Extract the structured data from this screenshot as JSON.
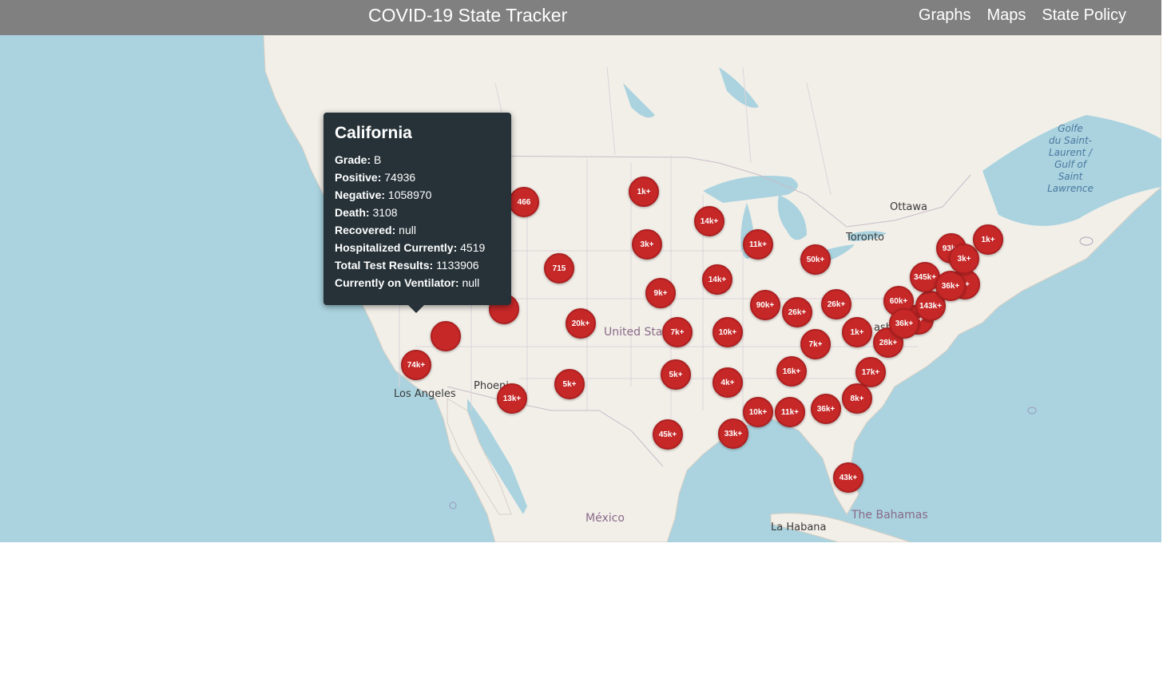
{
  "header": {
    "title": "COVID-19 State Tracker",
    "nav": [
      "Graphs",
      "Maps",
      "State Policy"
    ]
  },
  "map": {
    "water_color": "#aad3df",
    "land_color": "#f2efe9",
    "marker_color": "#c62828",
    "labels": {
      "ottawa": "Ottawa",
      "toronto": "Toronto",
      "los_angeles": "Los Angeles",
      "phoenix": "Phoeni",
      "united_states": "United Sta",
      "mexico": "México",
      "la_habana": "La Habana",
      "bahamas": "The Bahamas",
      "washington": "ash",
      "gulf_line1": "Golfe",
      "gulf_line2": "du Saint-",
      "gulf_line3": "Laurent /",
      "gulf_line4": "Gulf of",
      "gulf_line5": "Saint",
      "gulf_line6": "Lawrence"
    },
    "markers": [
      {
        "label": "466"
      },
      {
        "label": "1k+"
      },
      {
        "label": "14k+"
      },
      {
        "label": "3k+"
      },
      {
        "label": "11k+"
      },
      {
        "label": "715"
      },
      {
        "label": "50k+"
      },
      {
        "label": "14k+"
      },
      {
        "label": "9k+"
      },
      {
        "label": "90k+"
      },
      {
        "label": "26k+"
      },
      {
        "label": "26k+"
      },
      {
        "label": "20k+"
      },
      {
        "label": "7k+"
      },
      {
        "label": "10k+"
      },
      {
        "label": "1k+"
      },
      {
        "label": "7k+"
      },
      {
        "label": "74k+"
      },
      {
        "label": "16k+"
      },
      {
        "label": "5k+"
      },
      {
        "label": "4k+"
      },
      {
        "label": "17k+"
      },
      {
        "label": "5k+"
      },
      {
        "label": "13k+"
      },
      {
        "label": "8k+"
      },
      {
        "label": "10k+"
      },
      {
        "label": "11k+"
      },
      {
        "label": "36k+"
      },
      {
        "label": "45k+"
      },
      {
        "label": "33k+"
      },
      {
        "label": "43k+"
      },
      {
        "label": "28k+"
      },
      {
        "label": "60k+"
      },
      {
        "label": "36k+"
      },
      {
        "label": "143k+"
      },
      {
        "label": "345k+"
      },
      {
        "label": "36k+"
      },
      {
        "label": "93k+"
      },
      {
        "label": "3k+"
      },
      {
        "label": "1k+"
      },
      {
        "label": "k+"
      },
      {
        "label": "k+"
      },
      {
        "label": ""
      },
      {
        "label": ""
      }
    ]
  },
  "popup": {
    "state": "California",
    "rows": [
      {
        "key": "Grade:",
        "value": "B"
      },
      {
        "key": "Positive:",
        "value": "74936"
      },
      {
        "key": "Negative:",
        "value": "1058970"
      },
      {
        "key": "Death:",
        "value": "3108"
      },
      {
        "key": "Recovered:",
        "value": "null"
      },
      {
        "key": "Hospitalized Currently:",
        "value": "4519"
      },
      {
        "key": "Total Test Results:",
        "value": "1133906"
      },
      {
        "key": "Currently on Ventilator:",
        "value": "null"
      }
    ]
  }
}
